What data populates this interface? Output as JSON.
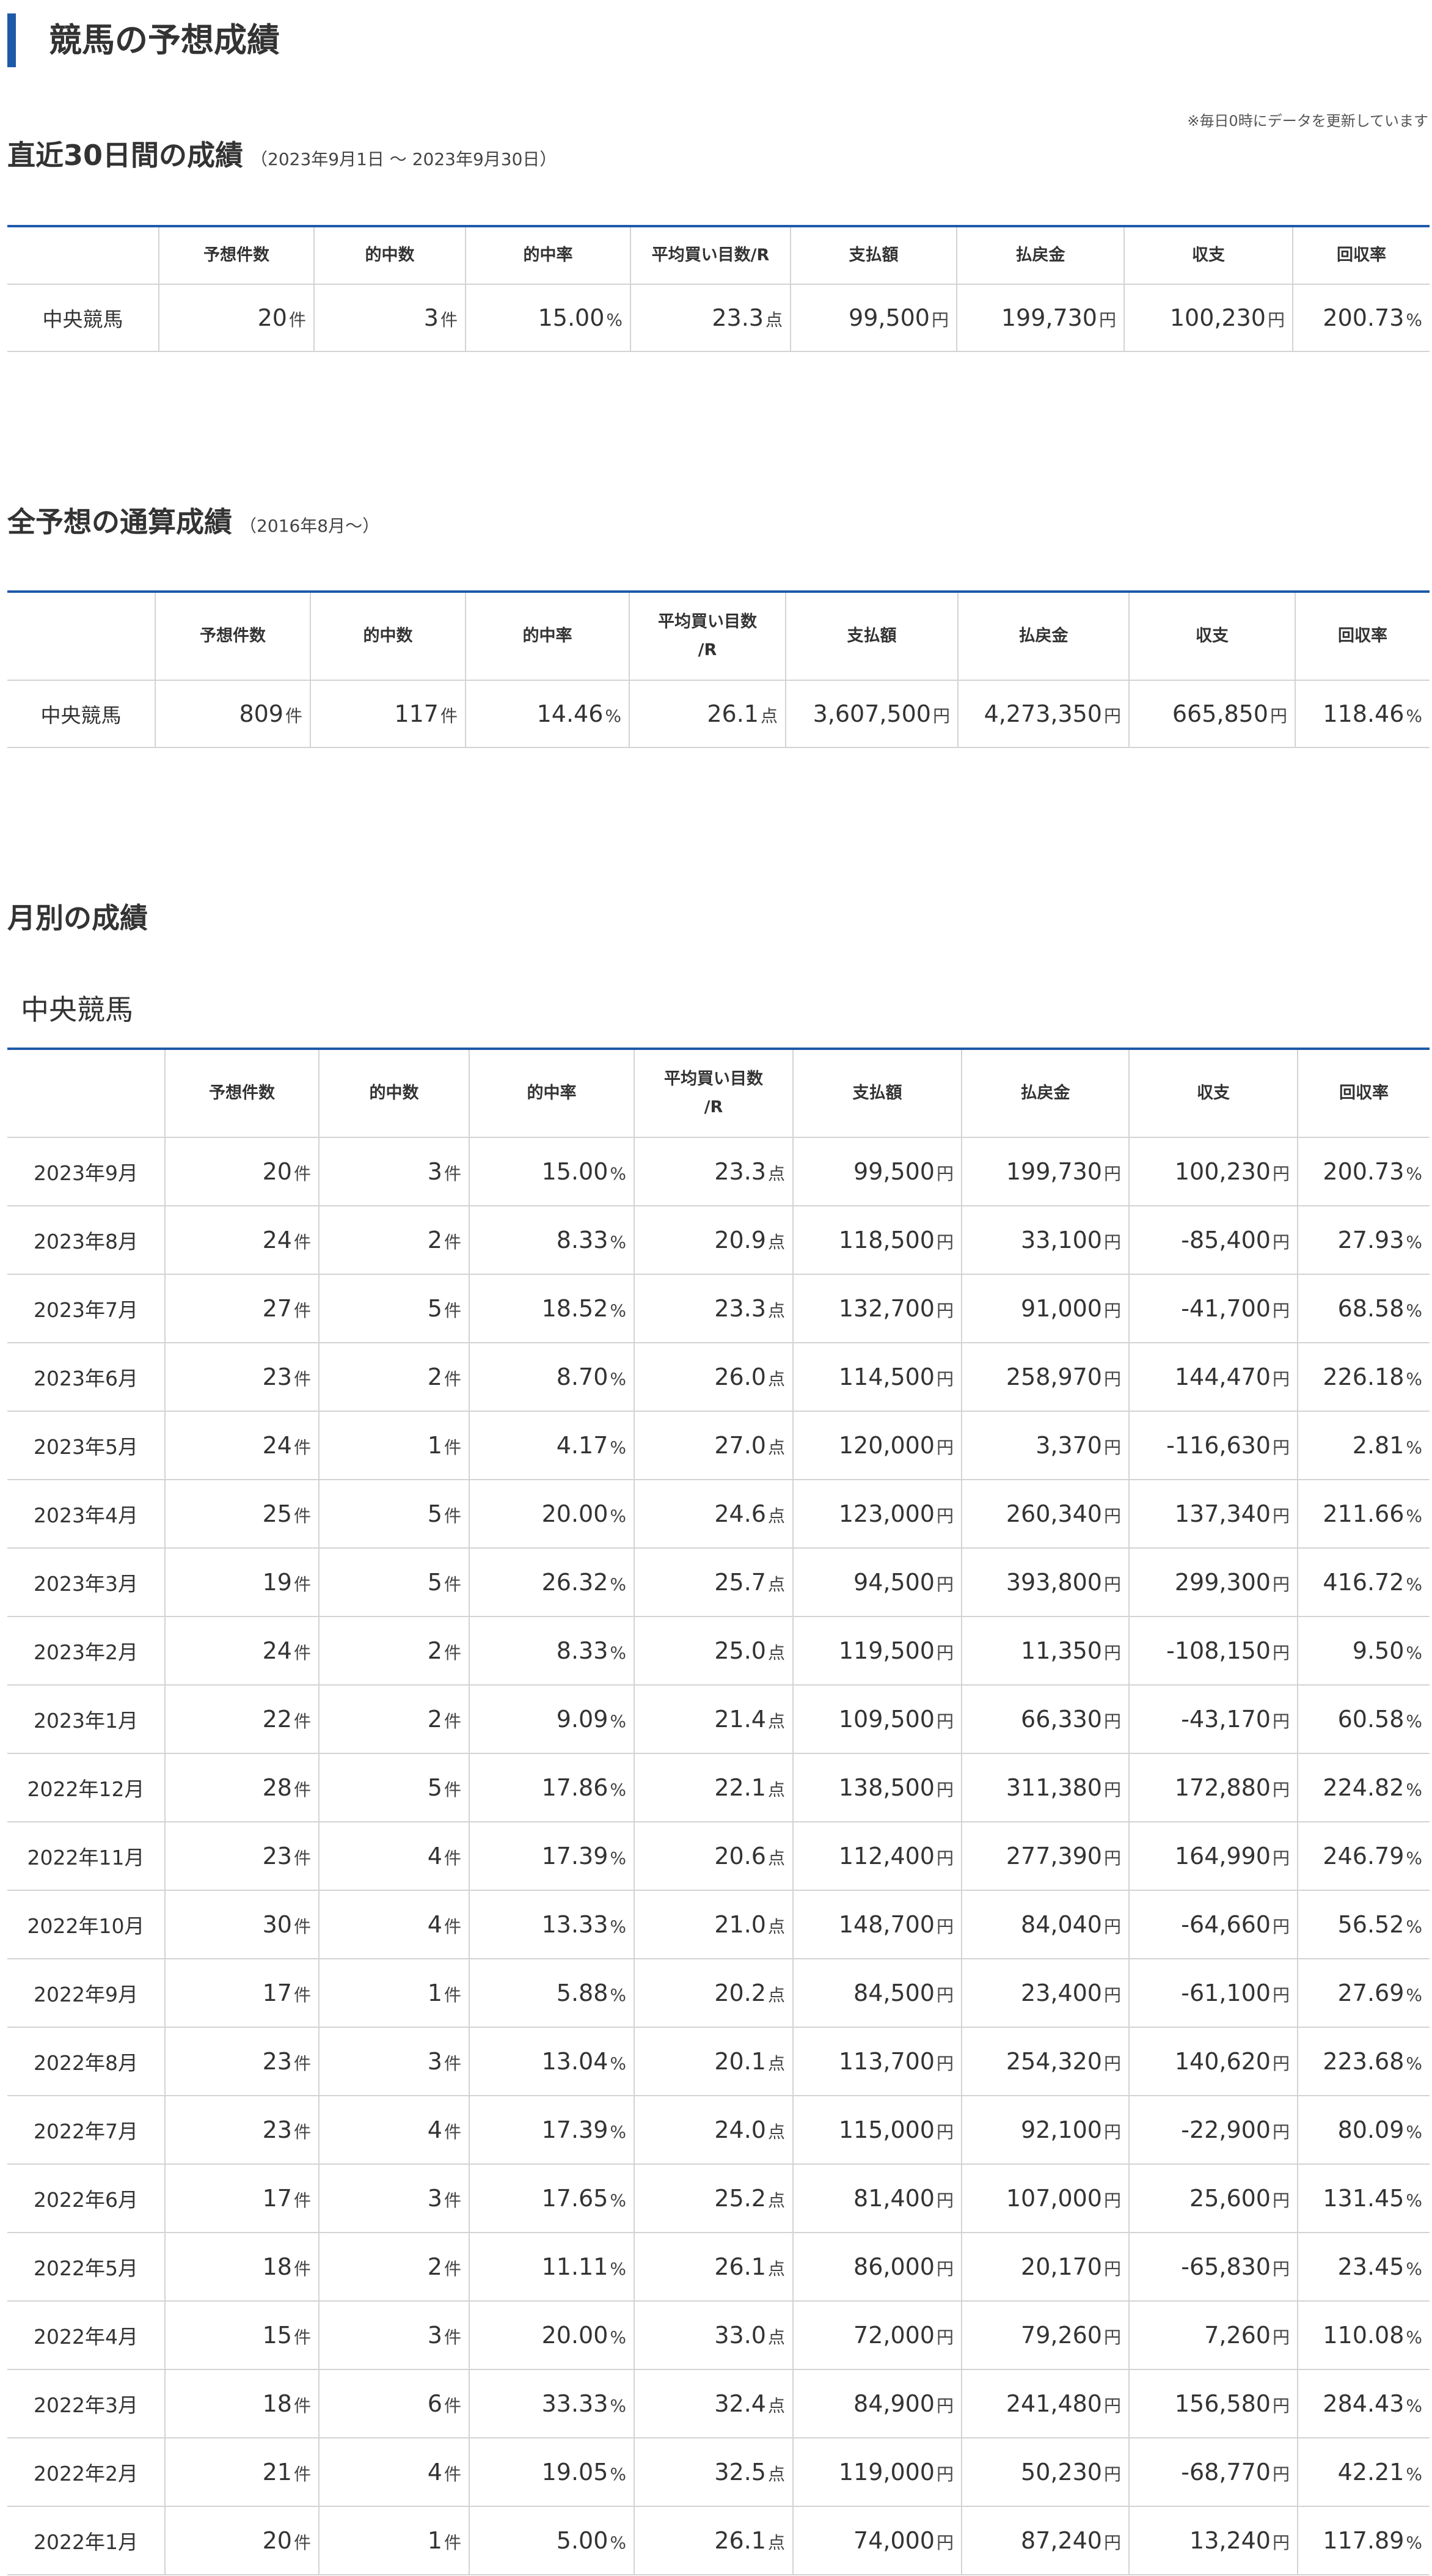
{
  "page": {
    "title": "競馬の予想成績",
    "update_note": "※毎日0時にデータを更新しています"
  },
  "columns": [
    "",
    "予想件数",
    "的中数",
    "的中率",
    "平均買い目数/R",
    "支払額",
    "払戻金",
    "収支",
    "回収率"
  ],
  "columns_wrapped": {
    "avg_line1": "平均買い目数",
    "avg_line2": "/R"
  },
  "units": {
    "count": "件",
    "percent": "%",
    "points": "点",
    "yen": "円"
  },
  "recent": {
    "heading": "直近30日間の成績",
    "period": "（2023年9月1日 ～ 2023年9月30日）",
    "rows": [
      {
        "label": "中央競馬",
        "predictions": "20",
        "hits": "3",
        "hit_rate": "15.00",
        "avg_bets": "23.3",
        "paid": "99,500",
        "payout": "199,730",
        "balance": "100,230",
        "return_rate": "200.73"
      }
    ]
  },
  "total": {
    "heading": "全予想の通算成績",
    "period": "（2016年8月～）",
    "rows": [
      {
        "label": "中央競馬",
        "predictions": "809",
        "hits": "117",
        "hit_rate": "14.46",
        "avg_bets": "26.1",
        "paid": "3,607,500",
        "payout": "4,273,350",
        "balance": "665,850",
        "return_rate": "118.46"
      }
    ]
  },
  "monthly": {
    "heading": "月別の成績",
    "subheading": "中央競馬",
    "rows": [
      {
        "label": "2023年9月",
        "predictions": "20",
        "hits": "3",
        "hit_rate": "15.00",
        "avg_bets": "23.3",
        "paid": "99,500",
        "payout": "199,730",
        "balance": "100,230",
        "return_rate": "200.73"
      },
      {
        "label": "2023年8月",
        "predictions": "24",
        "hits": "2",
        "hit_rate": "8.33",
        "avg_bets": "20.9",
        "paid": "118,500",
        "payout": "33,100",
        "balance": "-85,400",
        "return_rate": "27.93"
      },
      {
        "label": "2023年7月",
        "predictions": "27",
        "hits": "5",
        "hit_rate": "18.52",
        "avg_bets": "23.3",
        "paid": "132,700",
        "payout": "91,000",
        "balance": "-41,700",
        "return_rate": "68.58"
      },
      {
        "label": "2023年6月",
        "predictions": "23",
        "hits": "2",
        "hit_rate": "8.70",
        "avg_bets": "26.0",
        "paid": "114,500",
        "payout": "258,970",
        "balance": "144,470",
        "return_rate": "226.18"
      },
      {
        "label": "2023年5月",
        "predictions": "24",
        "hits": "1",
        "hit_rate": "4.17",
        "avg_bets": "27.0",
        "paid": "120,000",
        "payout": "3,370",
        "balance": "-116,630",
        "return_rate": "2.81"
      },
      {
        "label": "2023年4月",
        "predictions": "25",
        "hits": "5",
        "hit_rate": "20.00",
        "avg_bets": "24.6",
        "paid": "123,000",
        "payout": "260,340",
        "balance": "137,340",
        "return_rate": "211.66"
      },
      {
        "label": "2023年3月",
        "predictions": "19",
        "hits": "5",
        "hit_rate": "26.32",
        "avg_bets": "25.7",
        "paid": "94,500",
        "payout": "393,800",
        "balance": "299,300",
        "return_rate": "416.72"
      },
      {
        "label": "2023年2月",
        "predictions": "24",
        "hits": "2",
        "hit_rate": "8.33",
        "avg_bets": "25.0",
        "paid": "119,500",
        "payout": "11,350",
        "balance": "-108,150",
        "return_rate": "9.50"
      },
      {
        "label": "2023年1月",
        "predictions": "22",
        "hits": "2",
        "hit_rate": "9.09",
        "avg_bets": "21.4",
        "paid": "109,500",
        "payout": "66,330",
        "balance": "-43,170",
        "return_rate": "60.58"
      },
      {
        "label": "2022年12月",
        "predictions": "28",
        "hits": "5",
        "hit_rate": "17.86",
        "avg_bets": "22.1",
        "paid": "138,500",
        "payout": "311,380",
        "balance": "172,880",
        "return_rate": "224.82"
      },
      {
        "label": "2022年11月",
        "predictions": "23",
        "hits": "4",
        "hit_rate": "17.39",
        "avg_bets": "20.6",
        "paid": "112,400",
        "payout": "277,390",
        "balance": "164,990",
        "return_rate": "246.79"
      },
      {
        "label": "2022年10月",
        "predictions": "30",
        "hits": "4",
        "hit_rate": "13.33",
        "avg_bets": "21.0",
        "paid": "148,700",
        "payout": "84,040",
        "balance": "-64,660",
        "return_rate": "56.52"
      },
      {
        "label": "2022年9月",
        "predictions": "17",
        "hits": "1",
        "hit_rate": "5.88",
        "avg_bets": "20.2",
        "paid": "84,500",
        "payout": "23,400",
        "balance": "-61,100",
        "return_rate": "27.69"
      },
      {
        "label": "2022年8月",
        "predictions": "23",
        "hits": "3",
        "hit_rate": "13.04",
        "avg_bets": "20.1",
        "paid": "113,700",
        "payout": "254,320",
        "balance": "140,620",
        "return_rate": "223.68"
      },
      {
        "label": "2022年7月",
        "predictions": "23",
        "hits": "4",
        "hit_rate": "17.39",
        "avg_bets": "24.0",
        "paid": "115,000",
        "payout": "92,100",
        "balance": "-22,900",
        "return_rate": "80.09"
      },
      {
        "label": "2022年6月",
        "predictions": "17",
        "hits": "3",
        "hit_rate": "17.65",
        "avg_bets": "25.2",
        "paid": "81,400",
        "payout": "107,000",
        "balance": "25,600",
        "return_rate": "131.45"
      },
      {
        "label": "2022年5月",
        "predictions": "18",
        "hits": "2",
        "hit_rate": "11.11",
        "avg_bets": "26.1",
        "paid": "86,000",
        "payout": "20,170",
        "balance": "-65,830",
        "return_rate": "23.45"
      },
      {
        "label": "2022年4月",
        "predictions": "15",
        "hits": "3",
        "hit_rate": "20.00",
        "avg_bets": "33.0",
        "paid": "72,000",
        "payout": "79,260",
        "balance": "7,260",
        "return_rate": "110.08"
      },
      {
        "label": "2022年3月",
        "predictions": "18",
        "hits": "6",
        "hit_rate": "33.33",
        "avg_bets": "32.4",
        "paid": "84,900",
        "payout": "241,480",
        "balance": "156,580",
        "return_rate": "284.43"
      },
      {
        "label": "2022年2月",
        "predictions": "21",
        "hits": "4",
        "hit_rate": "19.05",
        "avg_bets": "32.5",
        "paid": "119,000",
        "payout": "50,230",
        "balance": "-68,770",
        "return_rate": "42.21"
      },
      {
        "label": "2022年1月",
        "predictions": "20",
        "hits": "1",
        "hit_rate": "5.00",
        "avg_bets": "26.1",
        "paid": "74,000",
        "payout": "87,240",
        "balance": "13,240",
        "return_rate": "117.89"
      }
    ]
  }
}
